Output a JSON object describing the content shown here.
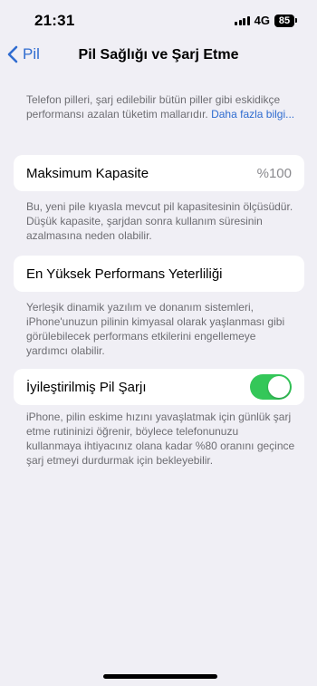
{
  "status_bar": {
    "time": "21:31",
    "network": "4G",
    "battery": "85"
  },
  "nav": {
    "back_label": "Pil",
    "title": "Pil Sağlığı ve Şarj Etme"
  },
  "intro": {
    "text": "Telefon pilleri, şarj edilebilir bütün piller gibi eskidikçe performansı azalan tüketim mallarıdır. ",
    "link": "Daha fazla bilgi..."
  },
  "max_capacity": {
    "label": "Maksimum Kapasite",
    "value": "%100",
    "footnote": "Bu, yeni pile kıyasla mevcut pil kapasitesinin ölçüsüdür. Düşük kapasite, şarjdan sonra kullanım süresinin azalmasına neden olabilir."
  },
  "peak_performance": {
    "label": "En Yüksek Performans Yeterliliği",
    "footnote": "Yerleşik dinamik yazılım ve donanım sistemleri, iPhone'unuzun pilinin kimyasal olarak yaşlanması gibi görülebilecek performans etkilerini engellemeye yardımcı olabilir."
  },
  "optimized_charging": {
    "label": "İyileştirilmiş Pil Şarjı",
    "enabled": true,
    "footnote": "iPhone, pilin eskime hızını yavaşlatmak için günlük şarj etme rutininizi öğrenir, böylece telefonunuzu kullanmaya ihtiyacınız olana kadar %80 oranını geçince şarj etmeyi durdurmak için bekleyebilir."
  },
  "colors": {
    "accent": "#2f6cd0",
    "toggle_on": "#34c759",
    "background": "#f0eff5"
  },
  "icons": {
    "back": "chevron-left-icon",
    "signal": "cellular-signal-icon",
    "battery": "battery-icon"
  }
}
